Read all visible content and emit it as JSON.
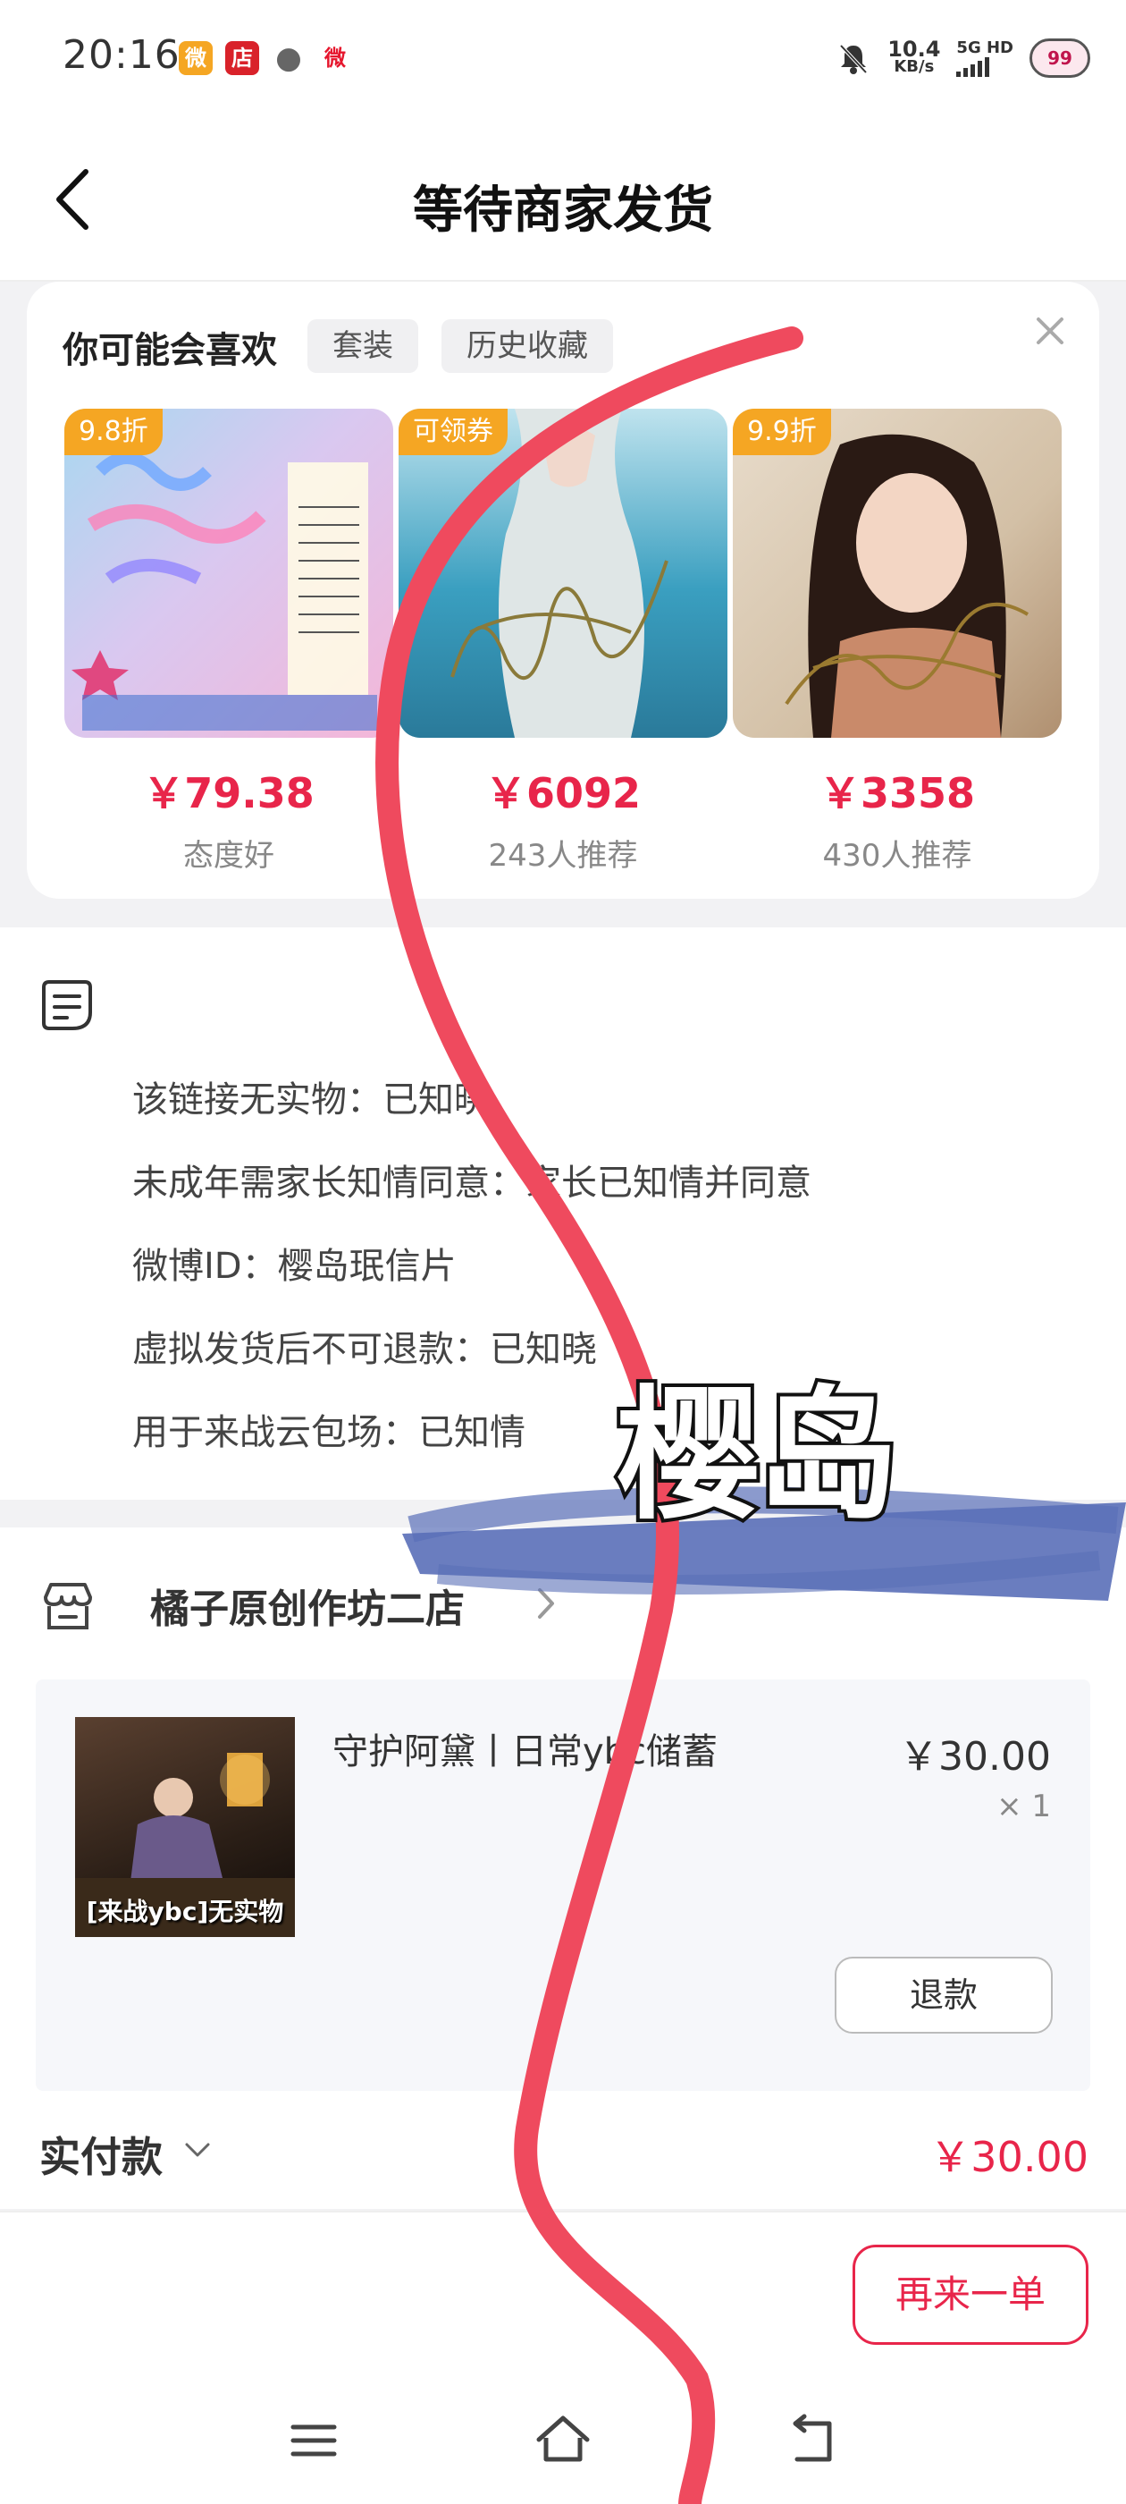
{
  "status_bar": {
    "time": "20:16",
    "apps": [
      {
        "icon": "weibo-icon",
        "color": "#f5a623",
        "glyph": "微"
      },
      {
        "icon": "store-icon",
        "color": "#d9222a",
        "glyph": "店"
      },
      {
        "icon": "wechat-icon",
        "color": "#666666",
        "glyph": "●"
      },
      {
        "icon": "weibo-icon",
        "color": "#e6162d",
        "glyph": "微"
      }
    ],
    "net_speed": "10.4",
    "net_unit": "KB/s",
    "net_type": "5G HD",
    "battery": "99"
  },
  "header": {
    "title": "等待商家发货"
  },
  "recommend": {
    "title": "你可能会喜欢",
    "tabs": [
      "套装",
      "历史收藏"
    ],
    "products": [
      {
        "badge": "9.8折",
        "price": "￥79.38",
        "sub": "态度好",
        "img_colors": [
          "#a8d8f0",
          "#f4b6d8"
        ]
      },
      {
        "badge": "可领券",
        "price": "￥6092",
        "sub": "243人推荐",
        "img_colors": [
          "#3a9fc0",
          "#cfd9d8"
        ]
      },
      {
        "badge": "9.9折",
        "price": "￥3358",
        "sub": "430人推荐",
        "img_colors": [
          "#d8c8b0",
          "#8a6a50"
        ]
      }
    ]
  },
  "info": {
    "lines": [
      "该链接无实物：已知晓",
      "未成年需家长知情同意：家长已知情并同意",
      "微博ID：樱岛珉信片",
      "虚拟发货后不可退款：已知晓",
      "用于来战云包场：已知情"
    ]
  },
  "order": {
    "shop_name": "橘子原创作坊二店",
    "item": {
      "title": "守护阿黛丨日常ybc储蓄",
      "thumb_label": "[来战ybc]无实物",
      "price": "￥30.00",
      "qty": "× 1"
    },
    "refund_label": "退款",
    "paid_label": "实付款",
    "paid_amount": "￥30.00"
  },
  "actions": {
    "reorder_label": "再来一单"
  },
  "overlay": {
    "sticker_text": "樱岛",
    "brush_color": "#5a6fb8",
    "line_color": "#ef4a5e"
  },
  "colors": {
    "accent": "#e8254a",
    "badge": "#f5a623"
  }
}
